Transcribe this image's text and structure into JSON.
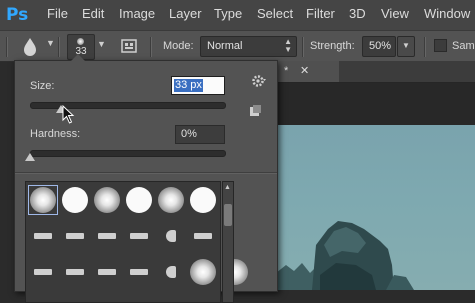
{
  "app": {
    "logo": "Ps"
  },
  "menu": [
    "File",
    "Edit",
    "Image",
    "Layer",
    "Type",
    "Select",
    "Filter",
    "3D",
    "View",
    "Window"
  ],
  "options_bar": {
    "tool_icon": "brush-tool-icon",
    "brush_size": "33",
    "mode_label": "Mode:",
    "mode_value": "Normal",
    "strength_label": "Strength:",
    "strength_value": "50%",
    "sample_label": "Samp"
  },
  "document_tab": {
    "mark": "*",
    "close": "✕"
  },
  "brush_panel": {
    "size_label": "Size:",
    "size_value": "33 px",
    "size_fraction": 0.16,
    "hardness_label": "Hardness:",
    "hardness_value": "0%",
    "hardness_fraction": 0.0,
    "presets_row1": [
      "soft-round",
      "hard-round",
      "soft-round",
      "hard-round",
      "soft-round",
      "hard-round"
    ],
    "presets_row2": [
      "stroke",
      "stroke",
      "stroke",
      "stroke",
      "fan",
      "stroke"
    ],
    "presets_row3": [
      "stroke",
      "stroke",
      "stroke",
      "stroke",
      "fan",
      "soft-round",
      "soft-round"
    ]
  },
  "colors": {
    "accent": "#31a8ff",
    "selection": "#3a6fc1",
    "panel_bg": "#535353"
  }
}
